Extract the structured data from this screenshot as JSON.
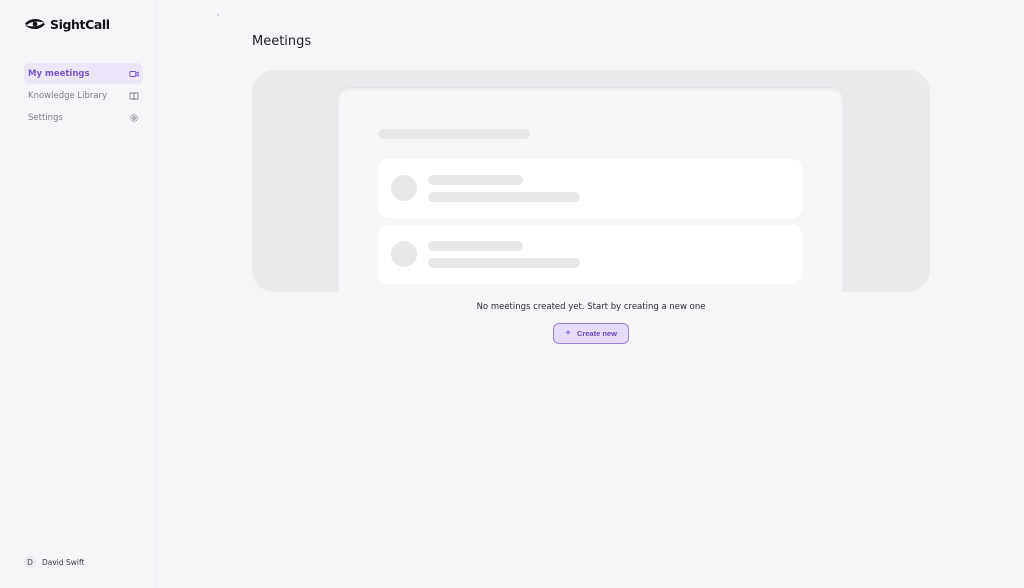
{
  "brand": {
    "name": "SightCall",
    "accent_color": "#7b55c7"
  },
  "sidebar": {
    "items": [
      {
        "label": "My meetings",
        "icon": "video-camera-icon",
        "active": true
      },
      {
        "label": "Knowledge Library",
        "icon": "book-icon",
        "active": false
      },
      {
        "label": "Settings",
        "icon": "gear-icon",
        "active": false
      }
    ],
    "user": {
      "initial": "D",
      "name": "David Swift"
    }
  },
  "main": {
    "title": "Meetings",
    "empty_state": {
      "message": "No meetings created yet. Start by creating a new one",
      "create_label": "Create new",
      "create_icon": "plus-icon"
    }
  }
}
